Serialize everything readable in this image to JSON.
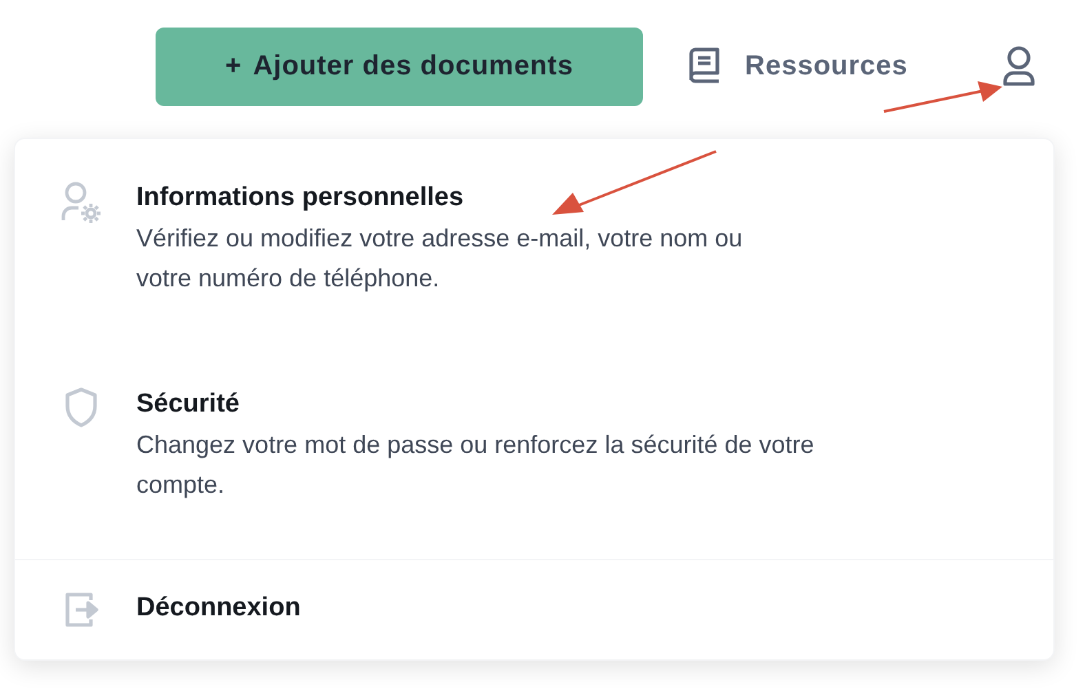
{
  "header": {
    "add_button": {
      "icon": "+",
      "label": "Ajouter des documents"
    },
    "resources_link": {
      "label": "Ressources"
    }
  },
  "account_menu": {
    "items": [
      {
        "kind": "profile",
        "title": "Informations personnelles",
        "description_lines": [
          "Vérifiez ou modifiez votre adresse e-mail, votre nom ou",
          "votre numéro de téléphone."
        ]
      },
      {
        "kind": "security",
        "title": "Sécurité",
        "description_lines": [
          "Changez votre mot de passe ou renforcez la sécurité de votre",
          "compte."
        ]
      },
      {
        "kind": "logout",
        "title": "Déconnexion"
      }
    ]
  }
}
